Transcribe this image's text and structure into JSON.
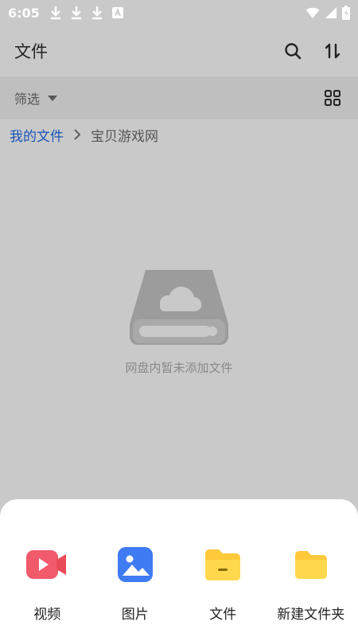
{
  "status_bar": {
    "time": "6:05",
    "left_icons": [
      "download-icon",
      "download-icon",
      "download-icon",
      "a-box-icon"
    ],
    "right_icons": [
      "wifi-icon",
      "signal-icon",
      "battery-icon"
    ]
  },
  "app_bar": {
    "title": "文件",
    "actions": [
      "search-icon",
      "sort-icon"
    ]
  },
  "filter_bar": {
    "label": "筛选",
    "view_toggle_icon": "grid-view-icon"
  },
  "breadcrumb": {
    "root": "我的文件",
    "separator": ">",
    "current": "宝贝游戏网"
  },
  "empty_state": {
    "icon": "cloud-drive-icon",
    "message": "网盘内暂未添加文件"
  },
  "bottom_sheet": {
    "items": [
      {
        "label": "视频",
        "icon": "video-icon",
        "color": "#F05A6B"
      },
      {
        "label": "图片",
        "icon": "image-icon",
        "color": "#3F7BF2"
      },
      {
        "label": "文件",
        "icon": "file-folder-icon",
        "color": "#FFC93C"
      },
      {
        "label": "新建文件夹",
        "icon": "new-folder-icon",
        "color": "#FFC93C"
      }
    ]
  },
  "colors": {
    "overlay_bg": "#c9c9c9",
    "filter_bg": "#bfbfbf",
    "link": "#1a55b8",
    "sheet_bg": "#ffffff"
  }
}
